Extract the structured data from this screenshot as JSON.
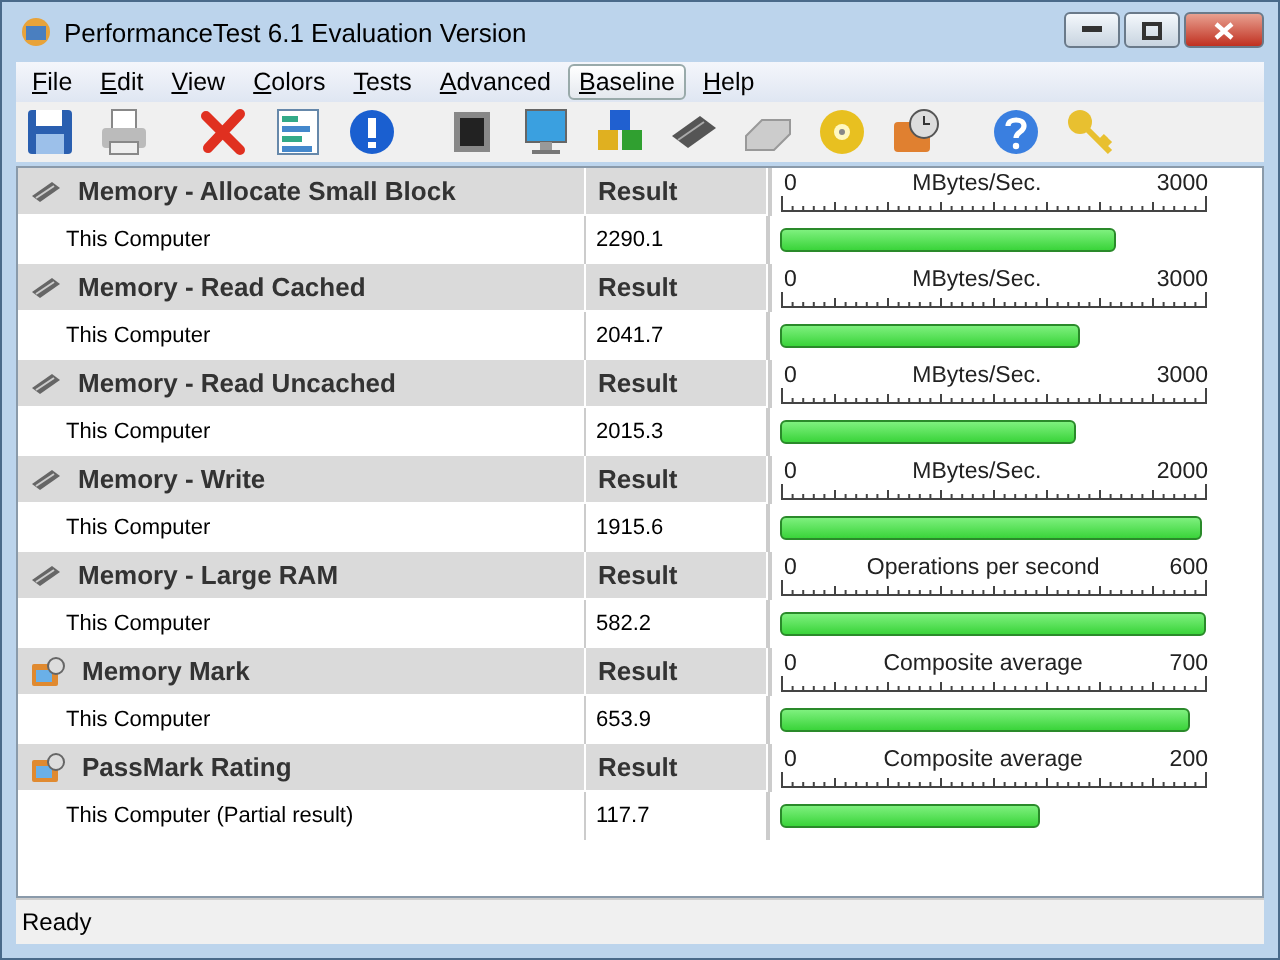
{
  "window": {
    "title": "PerformanceTest 6.1 Evaluation Version"
  },
  "menu": [
    {
      "label": "File",
      "selected": false
    },
    {
      "label": "Edit",
      "selected": false
    },
    {
      "label": "View",
      "selected": false
    },
    {
      "label": "Colors",
      "selected": false
    },
    {
      "label": "Tests",
      "selected": false
    },
    {
      "label": "Advanced",
      "selected": false
    },
    {
      "label": "Baseline",
      "selected": true
    },
    {
      "label": "Help",
      "selected": false
    }
  ],
  "groups": [
    {
      "kind": "memory",
      "title": "Memory - Allocate Small Block",
      "result_header": "Result",
      "scale": {
        "min": "0",
        "unit": "MBytes/Sec.",
        "max": "3000"
      },
      "rows": [
        {
          "name": "This Computer",
          "result": "2290.1",
          "level": 0.763
        }
      ]
    },
    {
      "kind": "memory",
      "title": "Memory - Read Cached",
      "result_header": "Result",
      "scale": {
        "min": "0",
        "unit": "MBytes/Sec.",
        "max": "3000"
      },
      "rows": [
        {
          "name": "This Computer",
          "result": "2041.7",
          "level": 0.68
        }
      ]
    },
    {
      "kind": "memory",
      "title": "Memory - Read Uncached",
      "result_header": "Result",
      "scale": {
        "min": "0",
        "unit": "MBytes/Sec.",
        "max": "3000"
      },
      "rows": [
        {
          "name": "This Computer",
          "result": "2015.3",
          "level": 0.672
        }
      ]
    },
    {
      "kind": "memory",
      "title": "Memory - Write",
      "result_header": "Result",
      "scale": {
        "min": "0",
        "unit": "MBytes/Sec.",
        "max": "2000"
      },
      "rows": [
        {
          "name": "This Computer",
          "result": "1915.6",
          "level": 0.958
        }
      ]
    },
    {
      "kind": "memory",
      "title": "Memory - Large RAM",
      "result_header": "Result",
      "scale": {
        "min": "0",
        "unit": "Operations per second",
        "max": "600"
      },
      "rows": [
        {
          "name": "This Computer",
          "result": "582.2",
          "level": 0.97
        }
      ]
    },
    {
      "kind": "mark",
      "title": "Memory Mark",
      "result_header": "Result",
      "scale": {
        "min": "0",
        "unit": "Composite average",
        "max": "700"
      },
      "rows": [
        {
          "name": "This Computer",
          "result": "653.9",
          "level": 0.934
        }
      ]
    },
    {
      "kind": "mark",
      "title": "PassMark Rating",
      "result_header": "Result",
      "scale": {
        "min": "0",
        "unit": "Composite average",
        "max": "200"
      },
      "rows": [
        {
          "name": "This Computer (Partial result)",
          "result": "117.7",
          "level": 0.589
        }
      ]
    }
  ],
  "status_bar": {
    "text": "Ready"
  }
}
